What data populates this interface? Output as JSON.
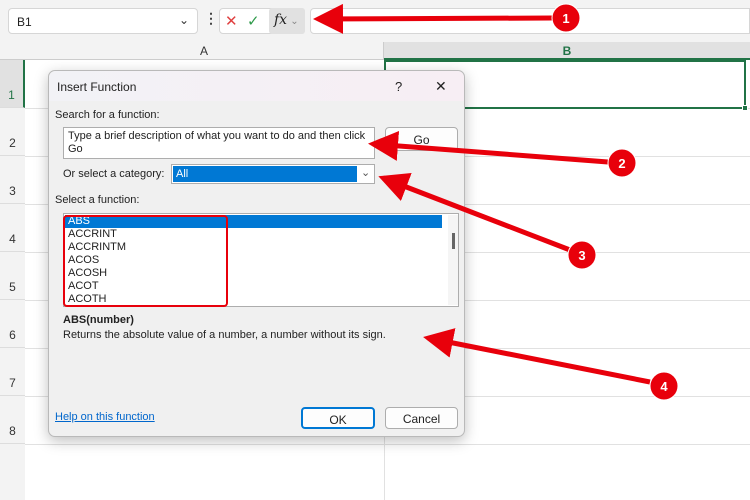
{
  "formula_bar": {
    "name_box": "B1",
    "cancel": "✕",
    "enter": "✓",
    "fx": "fx"
  },
  "columns": [
    "A",
    "B"
  ],
  "rows": [
    "1",
    "2",
    "3",
    "4",
    "5",
    "6",
    "7",
    "8"
  ],
  "dialog": {
    "title": "Insert Function",
    "help": "?",
    "close": "✕",
    "search_label": "Search for a function:",
    "search_value": "Type a brief description of what you want to do and then click Go",
    "go": "Go",
    "category_label": "Or select a category:",
    "category_value": "All",
    "select_label": "Select a function:",
    "functions": [
      "ABS",
      "ACCRINT",
      "ACCRINTM",
      "ACOS",
      "ACOSH",
      "ACOT",
      "ACOTH"
    ],
    "signature": "ABS(number)",
    "description": "Returns the absolute value of a number, a number without its sign.",
    "help_link": "Help on this function",
    "ok": "OK",
    "cancel": "Cancel"
  },
  "annotations": [
    "1",
    "2",
    "3",
    "4"
  ],
  "colors": {
    "accent": "#0078d4",
    "annotation": "#e8000b",
    "selection": "#217346"
  }
}
